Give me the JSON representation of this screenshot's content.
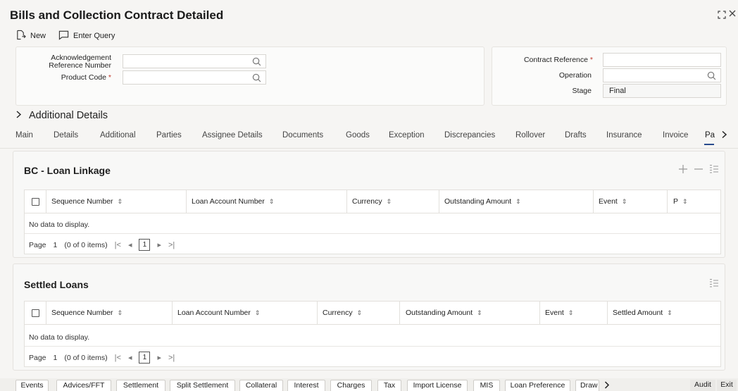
{
  "title": "Bills and Collection Contract Detailed",
  "toolbar": {
    "new_label": "New",
    "enter_query_label": "Enter Query"
  },
  "form": {
    "ack_ref_label": "Acknowledgement Reference Number",
    "product_code_label": "Product Code",
    "contract_ref_label": "Contract Reference",
    "operation_label": "Operation",
    "stage_label": "Stage",
    "stage_value": "Final"
  },
  "additional_details_label": "Additional Details",
  "tabs": [
    "Main",
    "Details",
    "Additional",
    "Parties",
    "Assignee Details",
    "Documents",
    "Goods",
    "Exception",
    "Discrepancies",
    "Rollover",
    "Drafts",
    "Insurance",
    "Invoice",
    "Pa"
  ],
  "loan_linkage": {
    "title": "BC - Loan Linkage",
    "columns": [
      "Sequence Number",
      "Loan Account Number",
      "Currency",
      "Outstanding Amount",
      "Event",
      "P"
    ],
    "no_data": "No data to display.",
    "page_label": "Page",
    "page_value": "1",
    "items_text": "(0 of 0 items)",
    "current_page": "1"
  },
  "settled_loans": {
    "title": "Settled Loans",
    "columns": [
      "Sequence Number",
      "Loan Account Number",
      "Currency",
      "Outstanding Amount",
      "Event",
      "Settled Amount"
    ],
    "no_data": "No data to display.",
    "page_label": "Page",
    "page_value": "1",
    "items_text": "(0 of 0 items)",
    "current_page": "1"
  },
  "bottom_tabs": [
    "Events",
    "Advices/FFT",
    "Settlement",
    "Split Settlement",
    "Collateral",
    "Interest",
    "Charges",
    "Tax",
    "Import License",
    "MIS",
    "Loan Preference",
    "Draw"
  ],
  "audit_label": "Audit",
  "exit_label": "Exit"
}
